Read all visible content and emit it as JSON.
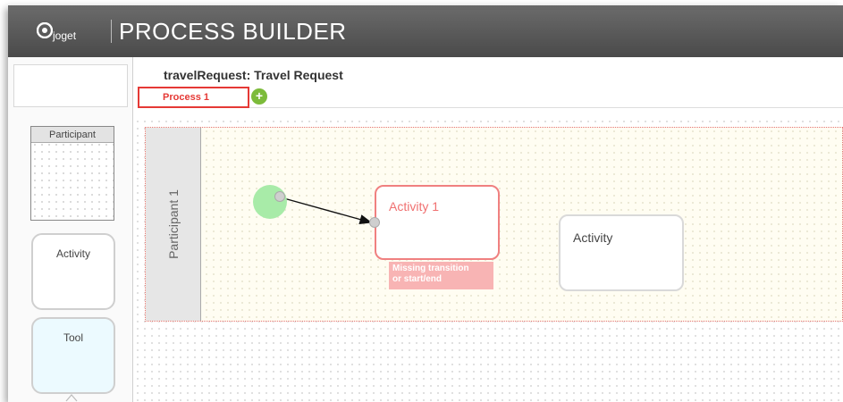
{
  "header": {
    "logo_text": "joget",
    "title": "PROCESS BUILDER"
  },
  "palette": {
    "participant_label": "Participant",
    "activity_label": "Activity",
    "tool_label": "Tool"
  },
  "process": {
    "title": "travelRequest: Travel Request",
    "tabs": [
      {
        "label": "Process 1",
        "active": true
      }
    ],
    "add_tab_symbol": "+"
  },
  "canvas": {
    "lane_label": "Participant 1",
    "activities": [
      {
        "label": "Activity 1",
        "state": "error",
        "warning": [
          "Missing transition",
          "or start/end"
        ]
      },
      {
        "label": "Activity",
        "state": "normal"
      }
    ]
  },
  "colors": {
    "header_bg": "#4f4f4f",
    "error": "#e53935",
    "add_button": "#7cbb3a",
    "start_node": "#a8eba8",
    "tool_bg": "#ecfaff"
  }
}
